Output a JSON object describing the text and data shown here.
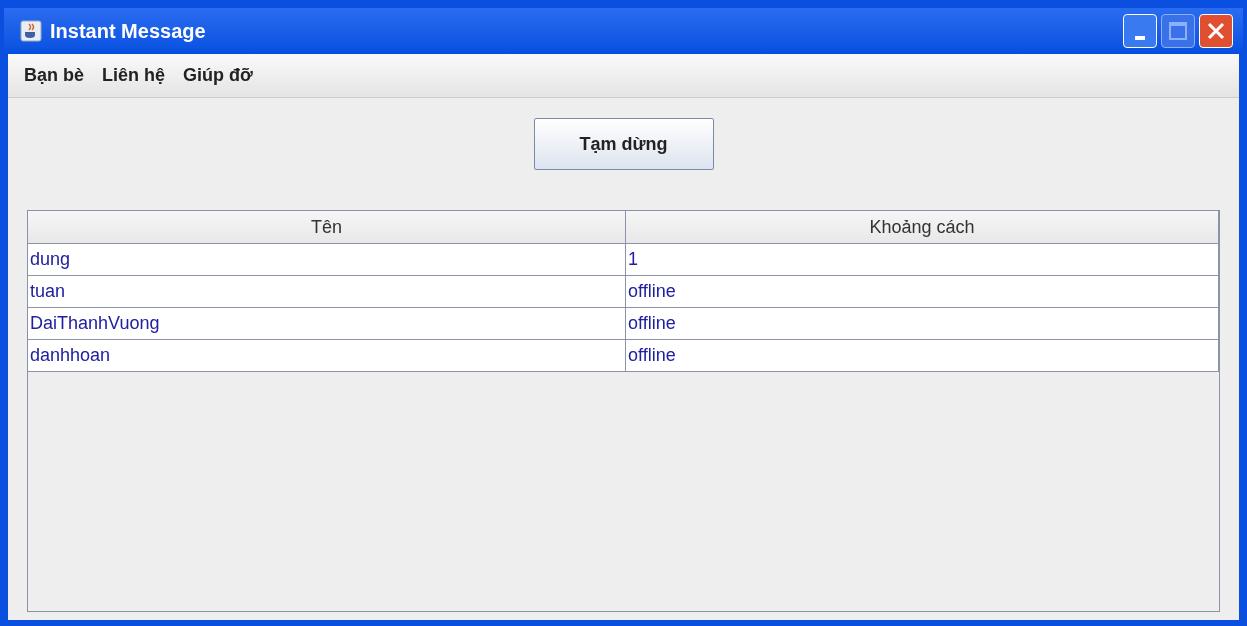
{
  "window": {
    "title": "Instant Message"
  },
  "menu": [
    "Bạn bè",
    "Liên hệ",
    "Giúp đỡ"
  ],
  "button": "Tạm dừng",
  "table": {
    "columns": [
      "Tên",
      "Khoảng cách"
    ],
    "rows": [
      [
        "dung",
        "1"
      ],
      [
        "tuan",
        "offline"
      ],
      [
        "DaiThanhVuong",
        "offline"
      ],
      [
        "danhhoan",
        "offline"
      ]
    ]
  }
}
